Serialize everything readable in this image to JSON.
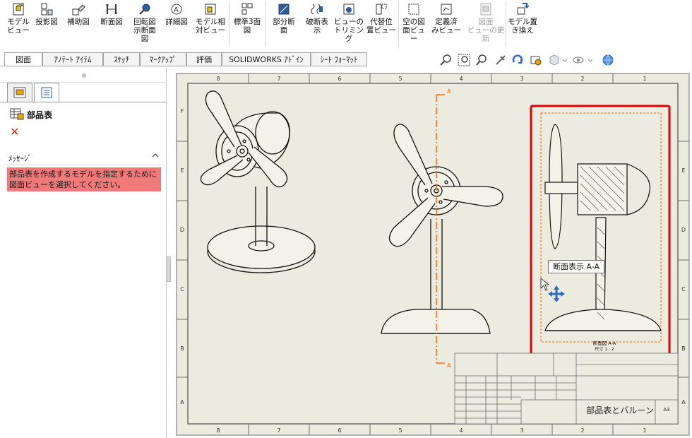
{
  "ribbon": {
    "buttons": [
      {
        "label": "モデル\nビュー",
        "icon": "model-view-icon"
      },
      {
        "label": "投影図",
        "icon": "projected-view-icon"
      },
      {
        "label": "補助図",
        "icon": "auxiliary-view-icon"
      },
      {
        "label": "断面図",
        "icon": "section-view-icon"
      },
      {
        "label": "回転図\n示断面\n図",
        "icon": "removed-section-icon"
      },
      {
        "label": "詳細図",
        "icon": "detail-view-icon"
      },
      {
        "label": "モデル相\n対ビュー",
        "icon": "relative-view-icon"
      },
      {
        "label": "標準3面\n図",
        "icon": "standard-3-view-icon"
      },
      {
        "label": "部分断\n面",
        "icon": "broken-out-section-icon"
      },
      {
        "label": "破断表\n示",
        "icon": "break-icon"
      },
      {
        "label": "ビューの\nトリミング",
        "icon": "crop-view-icon"
      },
      {
        "label": "代替位\n置ビュー",
        "icon": "alternate-position-icon"
      },
      {
        "label": "空の図\n面ビュー",
        "icon": "empty-view-icon"
      },
      {
        "label": "定義済\nみビュー",
        "icon": "predefined-view-icon"
      },
      {
        "label": "図面\nビューの更\n新",
        "icon": "update-views-icon",
        "disabled": true
      },
      {
        "label": "モデル置\nき換え",
        "icon": "replace-model-icon"
      }
    ]
  },
  "tabs": [
    "図面",
    "ｱﾉﾃｰﾄ ｱｲﾃﾑ",
    "ｽｹｯﾁ",
    "ﾏｰｸｱｯﾌﾟ",
    "評価",
    "SOLIDWORKS ｱﾄﾞｲﾝ",
    "ｼｰﾄ ﾌｫｰﾏｯﾄ"
  ],
  "property_manager": {
    "title": "部品表",
    "cancel_symbol": "✕",
    "message_header": "ﾒｯｾｰｼﾞ",
    "message_text": "部品表を作成するモデルを指定するために図面ビューを選択してください。"
  },
  "drawing": {
    "column_labels_top": [
      "8",
      "7",
      "6",
      "5",
      "4",
      "3",
      "2",
      "1"
    ],
    "row_labels": [
      "F",
      "E",
      "D",
      "C",
      "B",
      "A"
    ],
    "section_marker": "A",
    "section_view_caption": "断面図 A-A",
    "section_view_scale": "尺寸 1 : 2",
    "title_block_title": "部品表とバルーン",
    "title_block_size": "A3"
  },
  "tooltip": {
    "text": "断面表示 A-A"
  },
  "colors": {
    "accent": "#ff6a00",
    "selection": "#e20000",
    "paper": "#ecebdf",
    "message_bg": "#f07a7a"
  }
}
